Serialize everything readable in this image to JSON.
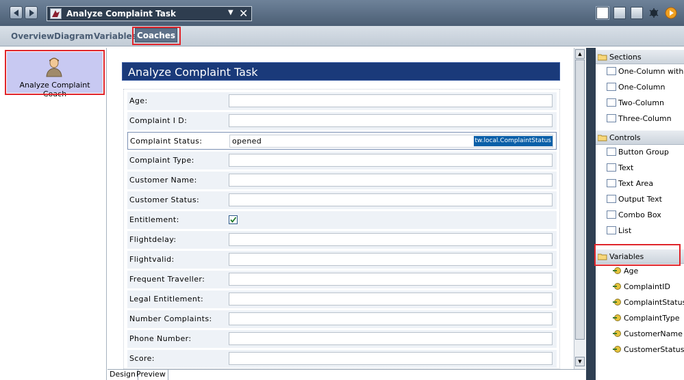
{
  "window": {
    "title": "Analyze Complaint Task"
  },
  "tabs": [
    "Overview",
    "Diagram",
    "Variables",
    "Coaches"
  ],
  "active_tab": "Coaches",
  "coaches": [
    {
      "label": "Analyze Complaint Coach"
    }
  ],
  "form": {
    "title": "Analyze Complaint Task",
    "fields": [
      {
        "label": "Age:",
        "type": "text",
        "value": ""
      },
      {
        "label": "Complaint I D:",
        "type": "text",
        "value": ""
      },
      {
        "label": "Complaint Status:",
        "type": "text",
        "value": "opened",
        "binding": "tw.local.ComplaintStatus",
        "selected": true
      },
      {
        "label": "Complaint Type:",
        "type": "text",
        "value": ""
      },
      {
        "label": "Customer Name:",
        "type": "text",
        "value": ""
      },
      {
        "label": "Customer Status:",
        "type": "text",
        "value": ""
      },
      {
        "label": "Entitlement:",
        "type": "checkbox",
        "checked": true
      },
      {
        "label": "Flightdelay:",
        "type": "text",
        "value": ""
      },
      {
        "label": "Flightvalid:",
        "type": "text",
        "value": ""
      },
      {
        "label": "Frequent Traveller:",
        "type": "text",
        "value": ""
      },
      {
        "label": "Legal Entitlement:",
        "type": "text",
        "value": ""
      },
      {
        "label": "Number Complaints:",
        "type": "text",
        "value": ""
      },
      {
        "label": "Phone Number:",
        "type": "text",
        "value": ""
      },
      {
        "label": "Score:",
        "type": "text",
        "value": ""
      }
    ]
  },
  "bottom_tabs": [
    "Design",
    "Preview"
  ],
  "palette": {
    "sections": {
      "title": "Sections",
      "items": [
        "One-Column with Ti",
        "One-Column",
        "Two-Column",
        "Three-Column"
      ]
    },
    "controls": {
      "title": "Controls",
      "items": [
        "Button Group",
        "Text",
        "Text Area",
        "Output Text",
        "Combo Box",
        "List"
      ]
    },
    "variables": {
      "title": "Variables",
      "items": [
        "Age",
        "ComplaintID",
        "ComplaintStatus",
        "ComplaintType",
        "CustomerName",
        "CustomerStatus"
      ]
    }
  },
  "colors": {
    "form_title_bg": "#1a3a7a",
    "highlight_border": "#e0242a",
    "binding_bg": "#0a5fa8"
  }
}
